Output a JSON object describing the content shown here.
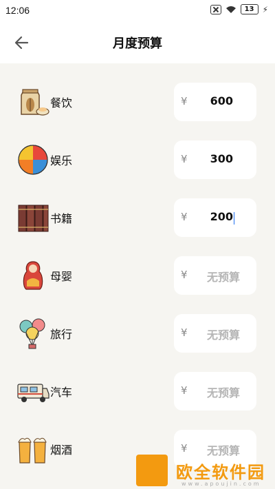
{
  "status": {
    "time": "12:06",
    "battery": "13"
  },
  "header": {
    "title": "月度预算"
  },
  "categories": [
    {
      "label": "餐饮",
      "amount": "600",
      "icon": "rice-bag-icon"
    },
    {
      "label": "娱乐",
      "amount": "300",
      "icon": "beach-ball-icon"
    },
    {
      "label": "书籍",
      "amount": "200",
      "icon": "books-icon"
    },
    {
      "label": "母婴",
      "amount": "无预算",
      "icon": "matryoshka-icon"
    },
    {
      "label": "旅行",
      "amount": "无预算",
      "icon": "balloons-icon"
    },
    {
      "label": "汽车",
      "amount": "无预算",
      "icon": "rv-icon"
    },
    {
      "label": "烟酒",
      "amount": "无预算",
      "icon": "beer-mugs-icon"
    }
  ],
  "currency": "¥",
  "watermark": {
    "text": "欧全软件园",
    "url": "www.apoujin.com"
  }
}
